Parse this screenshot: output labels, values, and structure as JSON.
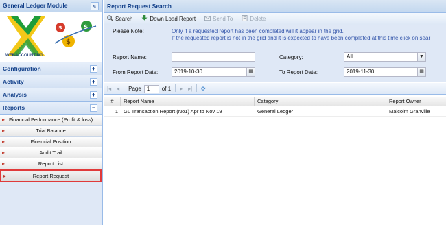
{
  "left": {
    "title": "General Ledger Module",
    "collapse_glyph": "«",
    "logo_text": "WEBACCOUNTING",
    "sections": [
      {
        "label": "Configuration",
        "toggle": "+"
      },
      {
        "label": "Activity",
        "toggle": "+"
      },
      {
        "label": "Analysis",
        "toggle": "+"
      },
      {
        "label": "Reports",
        "toggle": "−"
      }
    ],
    "reports": [
      "Financial Performance (Profit & loss)",
      "Trial Balance",
      "Financial Position",
      "Audit Trail",
      "Report List",
      "Report Request"
    ]
  },
  "right": {
    "title": "Report Request Search",
    "toolbar": {
      "search": "Search",
      "download": "Down Load Report",
      "send_to": "Send To",
      "delete": "Delete"
    },
    "note_label": "Please Note:",
    "note_line1": "Only if a requested report has been completed will it appear in the grid.",
    "note_line2": "If the requested report is not in the grid and it is expected to have been completed at this time click on sear",
    "report_name_label": "Report Name:",
    "report_name_value": "",
    "category_label": "Category:",
    "category_value": "All",
    "from_label": "From Report Date:",
    "from_value": "2019-10-30",
    "to_label": "To Report Date:",
    "to_value": "2019-11-30",
    "pager": {
      "page_label": "Page",
      "page_value": "1",
      "of_label": "of 1"
    },
    "grid": {
      "headers": [
        "#",
        "Report Name",
        "Category",
        "Report Owner"
      ],
      "rows": [
        {
          "num": "1",
          "name": "GL Transaction Report (No1) Apr to Nov 19",
          "category": "General Ledger",
          "owner": "Malcolm Granville"
        }
      ]
    }
  },
  "colors": {
    "accent": "#15428b",
    "border": "#99bbe8",
    "panel_bg": "#dfe8f6",
    "highlight": "#e03a3a"
  }
}
